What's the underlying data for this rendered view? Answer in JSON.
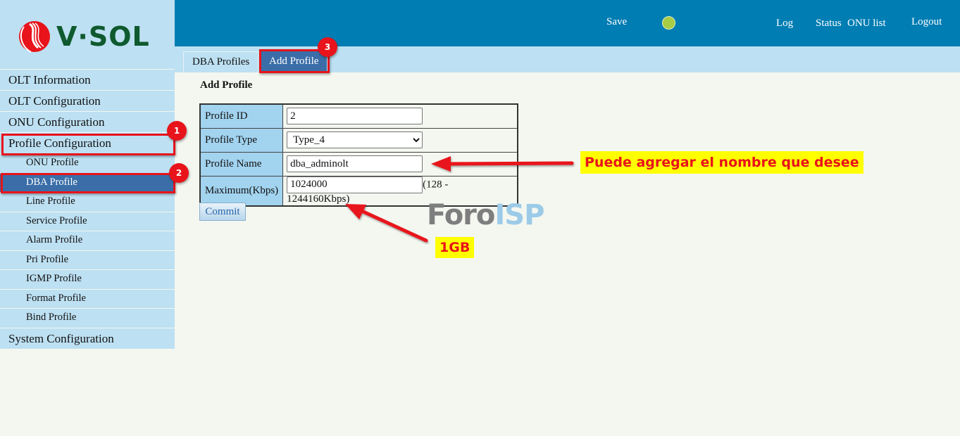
{
  "brand": {
    "name": "V·SOL",
    "logo_color": "#0f5a2e",
    "mark_color": "#e8131b"
  },
  "header": {
    "save_label": "Save",
    "status_indicator_color": "#a8cc44",
    "links": {
      "log": "Log",
      "status": "Status",
      "onu_list": "ONU list",
      "logout": "Logout"
    }
  },
  "tabs": [
    {
      "label": "DBA Profiles",
      "active": false
    },
    {
      "label": "Add Profile",
      "active": true
    }
  ],
  "sidebar": {
    "items": [
      {
        "label": "OLT Information",
        "level": "main"
      },
      {
        "label": "OLT Configuration",
        "level": "main"
      },
      {
        "label": "ONU Configuration",
        "level": "main"
      },
      {
        "label": "Profile Configuration",
        "level": "main",
        "expanded": true
      },
      {
        "label": "ONU Profile",
        "level": "sub"
      },
      {
        "label": "DBA Profile",
        "level": "sub",
        "active": true
      },
      {
        "label": "Line Profile",
        "level": "sub"
      },
      {
        "label": "Service Profile",
        "level": "sub"
      },
      {
        "label": "Alarm Profile",
        "level": "sub"
      },
      {
        "label": "Pri Profile",
        "level": "sub"
      },
      {
        "label": "IGMP Profile",
        "level": "sub"
      },
      {
        "label": "Format Profile",
        "level": "sub"
      },
      {
        "label": "Bind Profile",
        "level": "sub"
      },
      {
        "label": "System Configuration",
        "level": "main"
      }
    ]
  },
  "form": {
    "title": "Add Profile",
    "fields": {
      "profile_id": {
        "label": "Profile ID",
        "value": "2"
      },
      "profile_type": {
        "label": "Profile Type",
        "value": "Type_4"
      },
      "profile_name": {
        "label": "Profile Name",
        "value": "dba_adminolt"
      },
      "maximum": {
        "label": "Maximum(Kbps)",
        "value": "1024000",
        "range_note": "(128 - 1244160Kbps)"
      }
    },
    "commit_label": "Commit"
  },
  "annotations": {
    "badges": [
      "1",
      "2",
      "3"
    ],
    "name_hint": "Puede agregar el nombre que desee",
    "max_hint": "1GB",
    "highlight_color": "#e8131b",
    "callout_bg": "#ffff00"
  },
  "watermark": {
    "part1": "Foro",
    "part2": "ISP"
  }
}
